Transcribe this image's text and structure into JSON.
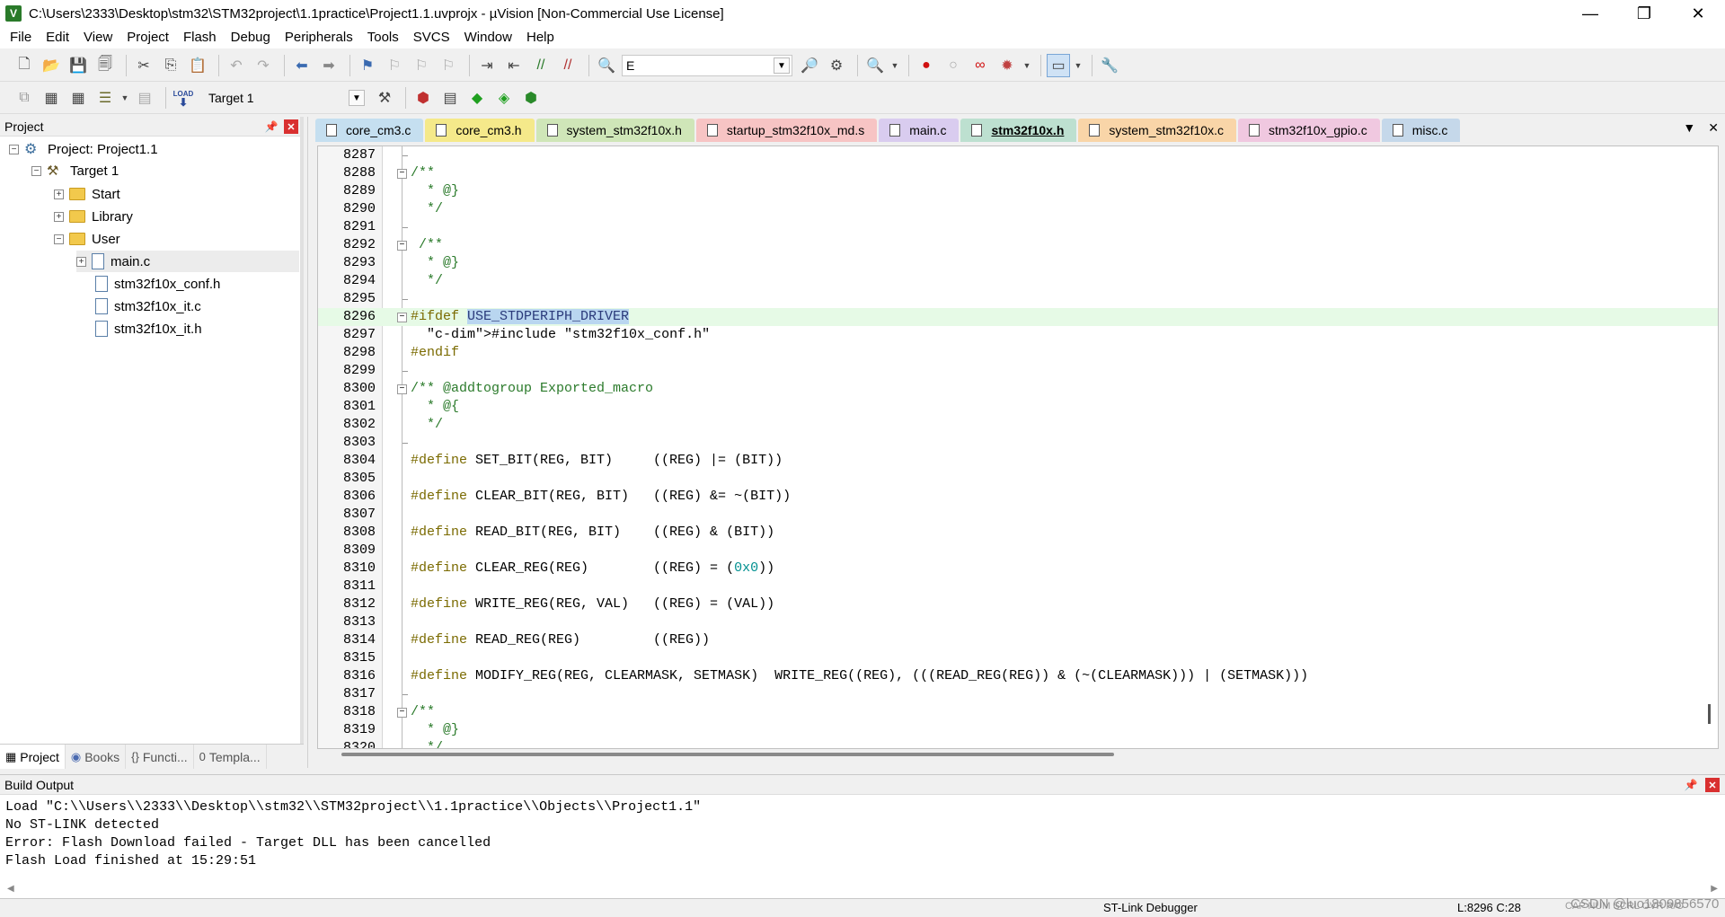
{
  "window": {
    "title": "C:\\Users\\2333\\Desktop\\stm32\\STM32project\\1.1practice\\Project1.1.uvprojx - µVision  [Non-Commercial Use License]",
    "app_icon": "V",
    "minimize": "—",
    "restore": "❐",
    "close": "✕"
  },
  "menu": [
    "File",
    "Edit",
    "View",
    "Project",
    "Flash",
    "Debug",
    "Peripherals",
    "Tools",
    "SVCS",
    "Window",
    "Help"
  ],
  "toolbar": {
    "find_value": "E",
    "target_value": "Target 1",
    "load_label": "LOAD"
  },
  "project_panel": {
    "title": "Project",
    "tree": {
      "project": "Project: Project1.1",
      "target": "Target 1",
      "groups": [
        "Start",
        "Library",
        "User"
      ],
      "user_files": [
        "main.c",
        "stm32f10x_conf.h",
        "stm32f10x_it.c",
        "stm32f10x_it.h"
      ]
    },
    "tabs": [
      "Project",
      "Books",
      "Functi...",
      "Templa..."
    ]
  },
  "editor": {
    "tabs": [
      {
        "label": "core_cm3.c",
        "color": "#c5dff0"
      },
      {
        "label": "core_cm3.h",
        "color": "#f5e98a"
      },
      {
        "label": "system_stm32f10x.h",
        "color": "#cfe6b8"
      },
      {
        "label": "startup_stm32f10x_md.s",
        "color": "#f7c4c4"
      },
      {
        "label": "main.c",
        "color": "#d9ccef"
      },
      {
        "label": "stm32f10x.h",
        "color": "#bde0d0"
      },
      {
        "label": "system_stm32f10x.c",
        "color": "#f9d5a8"
      },
      {
        "label": "stm32f10x_gpio.c",
        "color": "#f0c8e0"
      },
      {
        "label": "misc.c",
        "color": "#c5d8ea"
      }
    ],
    "active_tab": "stm32f10x.h",
    "lines": [
      {
        "n": "8287",
        "text": ""
      },
      {
        "n": "8288",
        "text": "/**"
      },
      {
        "n": "8289",
        "text": "  * @}"
      },
      {
        "n": "8290",
        "text": "  */"
      },
      {
        "n": "8291",
        "text": ""
      },
      {
        "n": "8292",
        "text": " /**"
      },
      {
        "n": "8293",
        "text": "  * @}"
      },
      {
        "n": "8294",
        "text": "  */"
      },
      {
        "n": "8295",
        "text": ""
      },
      {
        "n": "8296",
        "text": "#ifdef USE_STDPERIPH_DRIVER"
      },
      {
        "n": "8297",
        "text": "  #include \"stm32f10x_conf.h\""
      },
      {
        "n": "8298",
        "text": "#endif"
      },
      {
        "n": "8299",
        "text": ""
      },
      {
        "n": "8300",
        "text": "/** @addtogroup Exported_macro"
      },
      {
        "n": "8301",
        "text": "  * @{"
      },
      {
        "n": "8302",
        "text": "  */"
      },
      {
        "n": "8303",
        "text": ""
      },
      {
        "n": "8304",
        "text": "#define SET_BIT(REG, BIT)     ((REG) |= (BIT))"
      },
      {
        "n": "8305",
        "text": ""
      },
      {
        "n": "8306",
        "text": "#define CLEAR_BIT(REG, BIT)   ((REG) &= ~(BIT))"
      },
      {
        "n": "8307",
        "text": ""
      },
      {
        "n": "8308",
        "text": "#define READ_BIT(REG, BIT)    ((REG) & (BIT))"
      },
      {
        "n": "8309",
        "text": ""
      },
      {
        "n": "8310",
        "text": "#define CLEAR_REG(REG)        ((REG) = (0x0))"
      },
      {
        "n": "8311",
        "text": ""
      },
      {
        "n": "8312",
        "text": "#define WRITE_REG(REG, VAL)   ((REG) = (VAL))"
      },
      {
        "n": "8313",
        "text": ""
      },
      {
        "n": "8314",
        "text": "#define READ_REG(REG)         ((REG))"
      },
      {
        "n": "8315",
        "text": ""
      },
      {
        "n": "8316",
        "text": "#define MODIFY_REG(REG, CLEARMASK, SETMASK)  WRITE_REG((REG), (((READ_REG(REG)) & (~(CLEARMASK))) | (SETMASK)))"
      },
      {
        "n": "8317",
        "text": ""
      },
      {
        "n": "8318",
        "text": "/**"
      },
      {
        "n": "8319",
        "text": "  * @}"
      },
      {
        "n": "8320",
        "text": "  */"
      }
    ]
  },
  "build_output": {
    "title": "Build Output",
    "lines": [
      "Load \"C:\\\\Users\\\\2333\\\\Desktop\\\\stm32\\\\STM32project\\\\1.1practice\\\\Objects\\\\Project1.1\"",
      "No ST-LINK detected",
      "Error: Flash Download failed  -  Target DLL has been cancelled",
      "Flash Load finished at 15:29:51"
    ]
  },
  "status": {
    "debugger": "ST-Link Debugger",
    "position": "L:8296 C:28",
    "indicators": "CAP  NUM  SCRL  OVR  R/O",
    "watermark": "CSDN @luo1809856570"
  }
}
